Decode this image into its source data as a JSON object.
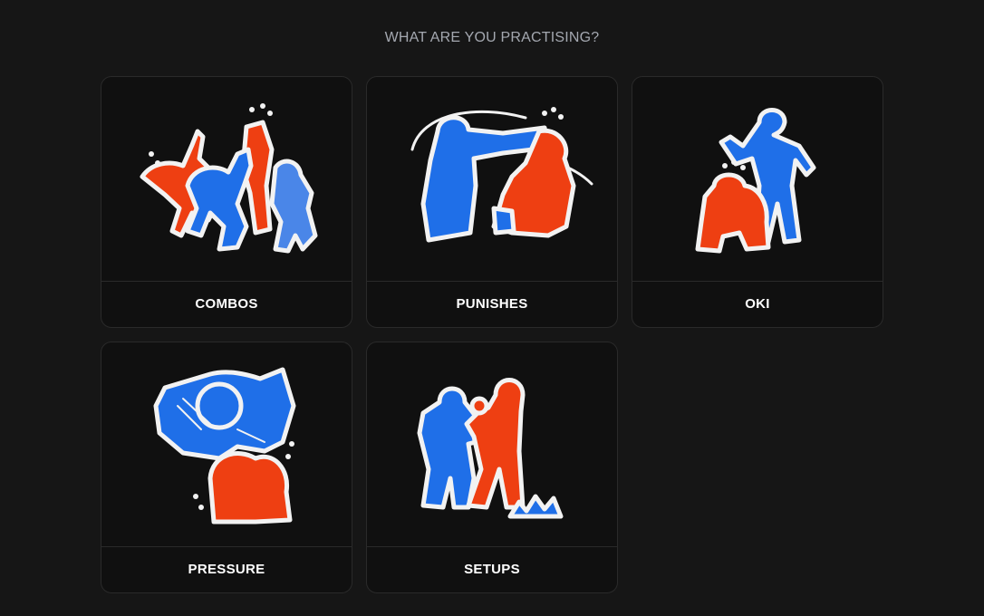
{
  "page": {
    "title": "WHAT ARE YOU PRACTISING?"
  },
  "options": [
    {
      "label": "COMBOS",
      "icon": "combos-illustration-icon"
    },
    {
      "label": "PUNISHES",
      "icon": "punishes-illustration-icon"
    },
    {
      "label": "OKI",
      "icon": "oki-illustration-icon"
    },
    {
      "label": "PRESSURE",
      "icon": "pressure-illustration-icon"
    },
    {
      "label": "SETUPS",
      "icon": "setups-illustration-icon"
    }
  ],
  "colors": {
    "background": "#161616",
    "card": "#101010",
    "border": "#2a2a2a",
    "blue": "#1f6fe8",
    "red": "#ee3f12",
    "outline": "#f2f2f2",
    "title": "#a4a8b0"
  }
}
